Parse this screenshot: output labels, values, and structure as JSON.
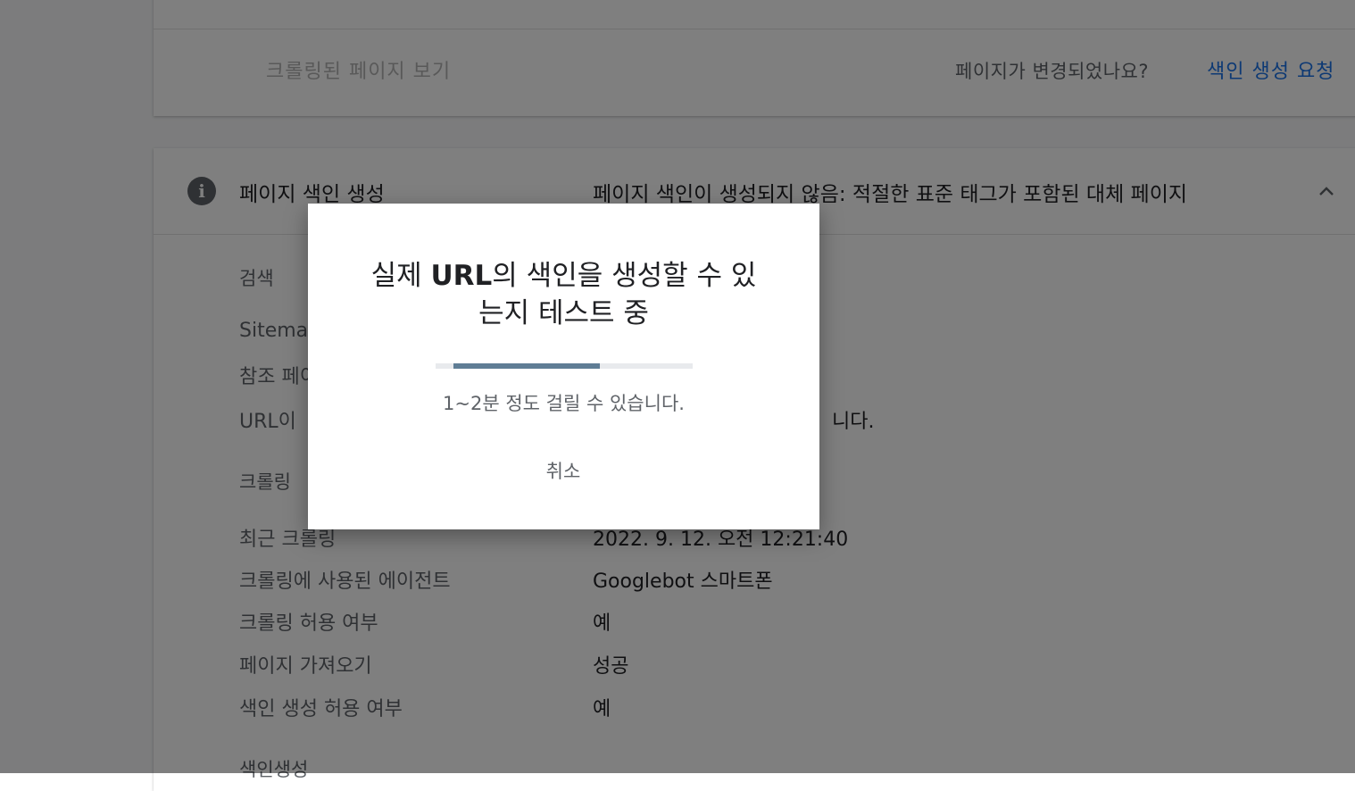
{
  "top_card": {
    "view_crawled_label": "크롤링된 페이지 보기",
    "page_changed_label": "페이지가 변경되었나요?",
    "request_index_label": "색인 생성 요청"
  },
  "index_section": {
    "title": "페이지 색인 생성",
    "status": "페이지 색인이 생성되지 않음: 적절한 표준 태그가 포함된 대체 페이지",
    "info_icon": "info-icon",
    "collapse_icon": "chevron-up-icon",
    "discovery": {
      "title": "검색",
      "rows": [
        {
          "label": "Sitemap",
          "value": ""
        },
        {
          "label": "참조 페이지",
          "value": ""
        },
        {
          "label": "URL이 ",
          "value": "니다."
        }
      ]
    },
    "crawl": {
      "title": "크롤링",
      "rows": [
        {
          "label": "최근 크롤링",
          "value": "2022. 9. 12. 오전 12:21:40"
        },
        {
          "label": "크롤링에 사용된 에이전트",
          "value": "Googlebot 스마트폰"
        },
        {
          "label": "크롤링 허용 여부",
          "value": "예"
        },
        {
          "label": "페이지 가져오기",
          "value": "성공"
        },
        {
          "label": "색인 생성 허용 여부",
          "value": "예"
        }
      ]
    },
    "indexing_title": "색인생성"
  },
  "dialog": {
    "title_line1_pre": "실제 ",
    "title_line1_bold": "URL",
    "title_line1_post": "의 색인을 생성할 수 있",
    "title_line2": "는지 테스트 중",
    "progress": 0.57,
    "description": "1~2분 정도 걸릴 수 있습니다.",
    "cancel_label": "취소"
  },
  "colors": {
    "accent": "#1a73e8",
    "progress": "#5f7d95",
    "scrim": "rgba(0,0,0,0.5)"
  }
}
